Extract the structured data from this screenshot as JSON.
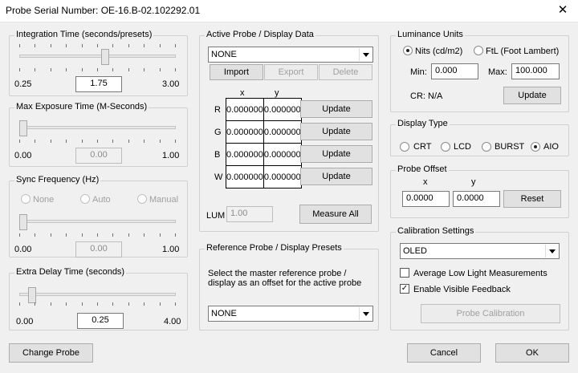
{
  "window": {
    "title": "Probe Serial Number: OE-16.B-02.102292.01",
    "close_glyph": "✕"
  },
  "integration": {
    "legend": "Integration Time (seconds/presets)",
    "min": "0.25",
    "value": "1.75",
    "max": "3.00",
    "level": 0.55
  },
  "exposure": {
    "legend": "Max Exposure Time (M-Seconds)",
    "min": "0.00",
    "value": "0.00",
    "max": "1.00",
    "level": 0.0
  },
  "sync": {
    "legend": "Sync Frequency (Hz)",
    "options": [
      "None",
      "Auto",
      "Manual"
    ],
    "min": "0.00",
    "value": "0.00",
    "max": "1.00",
    "level": 0.0
  },
  "delay": {
    "legend": "Extra Delay Time (seconds)",
    "min": "0.00",
    "value": "0.25",
    "max": "4.00",
    "level": 0.06
  },
  "change_probe": "Change Probe",
  "active": {
    "legend": "Active Probe / Display Data",
    "selected": "NONE",
    "import": "Import",
    "export": "Export",
    "delete": "Delete",
    "col_x": "x",
    "col_y": "y",
    "rows": [
      {
        "label": "R",
        "x": "0.000000",
        "y": "0.000000",
        "button": "Update"
      },
      {
        "label": "G",
        "x": "0.000000",
        "y": "0.000000",
        "button": "Update"
      },
      {
        "label": "B",
        "x": "0.000000",
        "y": "0.000000",
        "button": "Update"
      },
      {
        "label": "W",
        "x": "0.000000",
        "y": "0.000000",
        "button": "Update"
      }
    ],
    "lum_label": "LUM",
    "lum_value": "1.00",
    "measure_all": "Measure All"
  },
  "reference": {
    "legend": "Reference Probe / Display Presets",
    "desc_line1": "Select the master reference probe /",
    "desc_line2": "display as an offset for the active probe",
    "selected": "NONE"
  },
  "luminance": {
    "legend": "Luminance Units",
    "nits": "Nits (cd/m2)",
    "ftl": "FtL (Foot Lambert)",
    "min_label": "Min:",
    "min_value": "0.000",
    "max_label": "Max:",
    "max_value": "100.000",
    "cr": "CR: N/A",
    "update": "Update"
  },
  "display_type": {
    "legend": "Display Type",
    "options": [
      "CRT",
      "LCD",
      "BURST",
      "AIO"
    ],
    "selected": "AIO"
  },
  "offset": {
    "legend": "Probe Offset",
    "x_label": "x",
    "y_label": "y",
    "x_value": "0.0000",
    "y_value": "0.0000",
    "reset": "Reset"
  },
  "calibration": {
    "legend": "Calibration Settings",
    "selected": "OLED",
    "avg_low": "Average Low Light Measurements",
    "avg_low_checked": false,
    "visible_feedback": "Enable Visible Feedback",
    "visible_feedback_checked": true,
    "probe_calibration": "Probe Calibration"
  },
  "footer": {
    "cancel": "Cancel",
    "ok": "OK"
  }
}
